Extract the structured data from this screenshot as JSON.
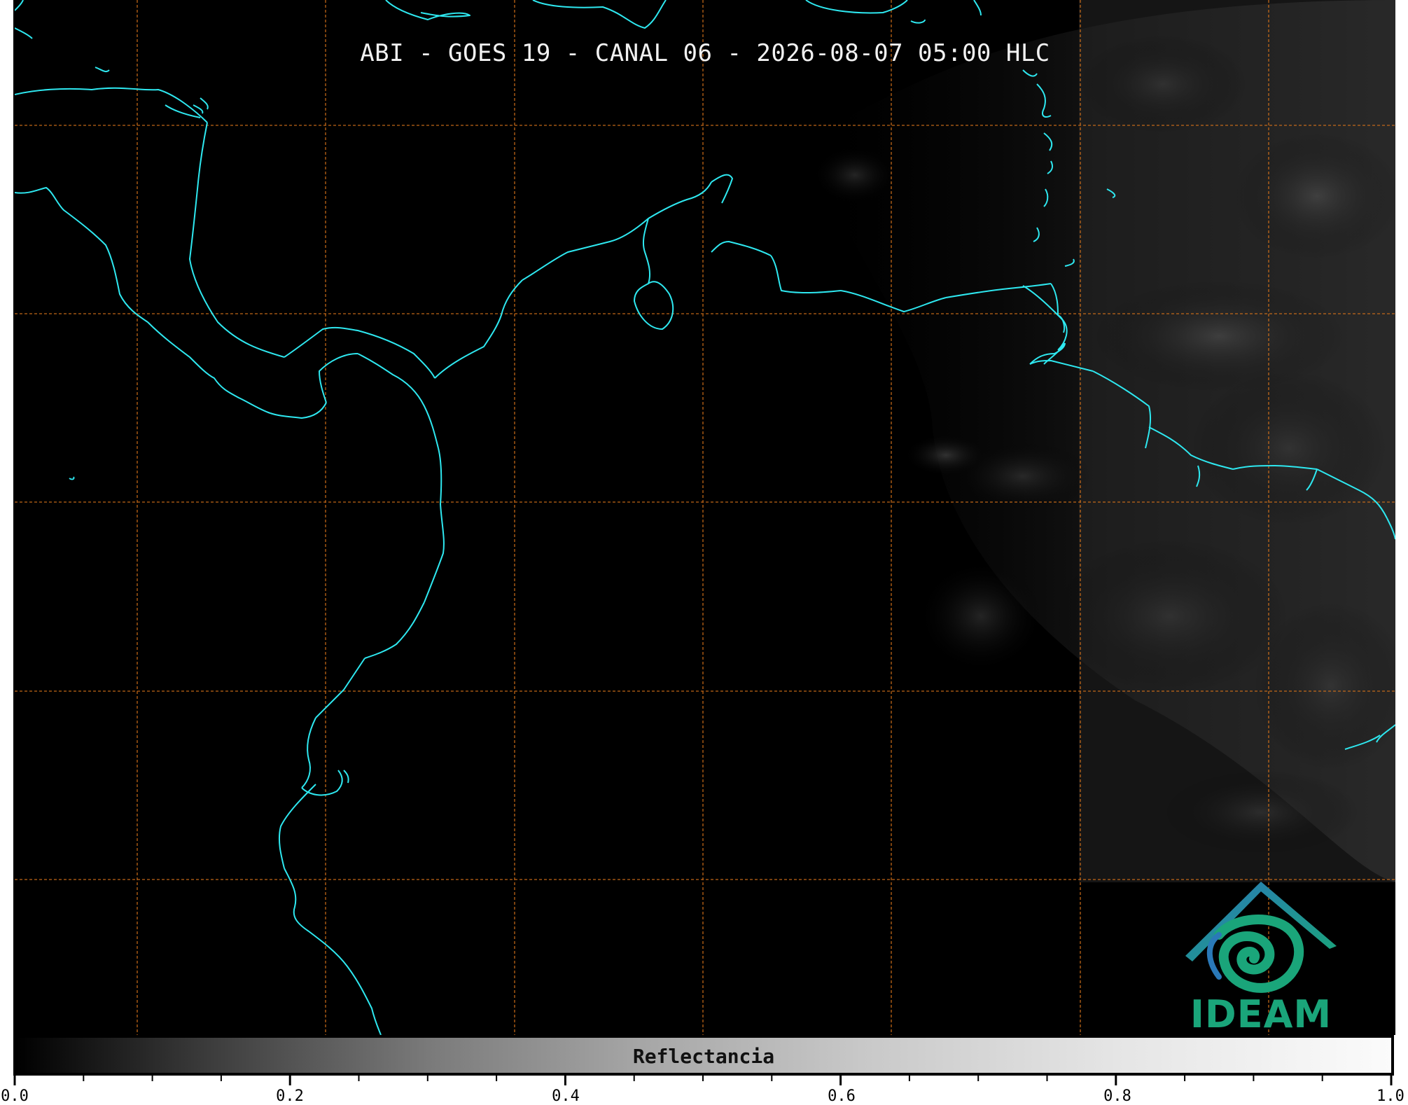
{
  "title": "ABI - GOES 19 - CANAL 06 - 2026-08-07 05:00 HLC",
  "colorbar": {
    "label": "Reflectancia",
    "tick_labels": [
      "0.0",
      "0.2",
      "0.4",
      "0.6",
      "0.8",
      "1.0"
    ],
    "range": [
      0.0,
      1.0
    ],
    "colormap": "grayscale"
  },
  "logo": {
    "text": "IDEAM"
  },
  "colors": {
    "coastline": "#2ee8f0",
    "gridline": "#d4711a",
    "background": "#000000",
    "logo_teal": "#1aa57a",
    "logo_blue": "#2a79b8"
  }
}
